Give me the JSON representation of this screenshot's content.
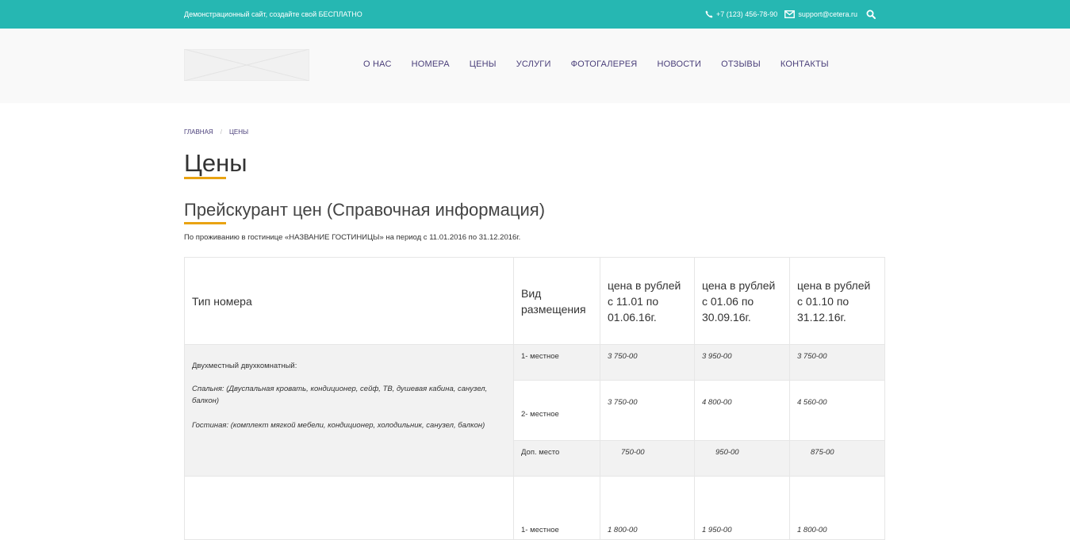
{
  "topbar": {
    "promo": "Демонстрационный сайт, создайте свой БЕСПЛАТНО",
    "phone": "+7 (123) 456-78-90",
    "email": "support@cetera.ru",
    "bg_color": "#26b7b2"
  },
  "nav": {
    "items": [
      "О НАС",
      "НОМЕРА",
      "ЦЕНЫ",
      "УСЛУГИ",
      "ФОТОГАЛЕРЕЯ",
      "НОВОСТИ",
      "ОТЗЫВЫ",
      "КОНТАКТЫ"
    ]
  },
  "breadcrumb": {
    "home": "ГЛАВНАЯ",
    "separator": "/",
    "current": "ЦЕНЫ"
  },
  "page": {
    "title": "Цены",
    "subtitle": "Прейскурант цен (Справочная информация)",
    "intro": "По проживанию в гостинице «НАЗВАНИЕ ГОСТИНИЦЫ» на период с 11.01.2016 по 31.12.2016г.",
    "accent_color": "#e9a312"
  },
  "table": {
    "headers": [
      "Тип номера",
      "Вид размещения",
      "цена в рублей с 11.01 по 01.06.16г.",
      "цена в рублей с 01.06 по 30.09.16г.",
      "цена в рублей с 01.10 по 31.12.16г."
    ],
    "room1": {
      "title": "Двухместный двухкомнатный:",
      "bedroom": "Спальня: (Двуспальная кровать, кондиционер, сейф, ТВ, душевая кабина, санузел, балкон)",
      "living": "Гостиная: (комплект мягкой мебели, кондиционер, холодильник, санузел, балкон)",
      "rows": [
        {
          "place": "1- местное",
          "p1": "3 750-00",
          "p2": "3 950-00",
          "p3": "3 750-00"
        },
        {
          "place": "2- местное",
          "p1": "3 750-00",
          "p2": "4 800-00",
          "p3": "4 560-00"
        },
        {
          "place": "Доп. место",
          "p1": "750-00",
          "p2": "950-00",
          "p3": "875-00"
        }
      ]
    },
    "room2": {
      "rows": [
        {
          "place": "1- местное",
          "p1": "1 800-00",
          "p2": "1 950-00",
          "p3": "1 800-00"
        }
      ]
    }
  }
}
